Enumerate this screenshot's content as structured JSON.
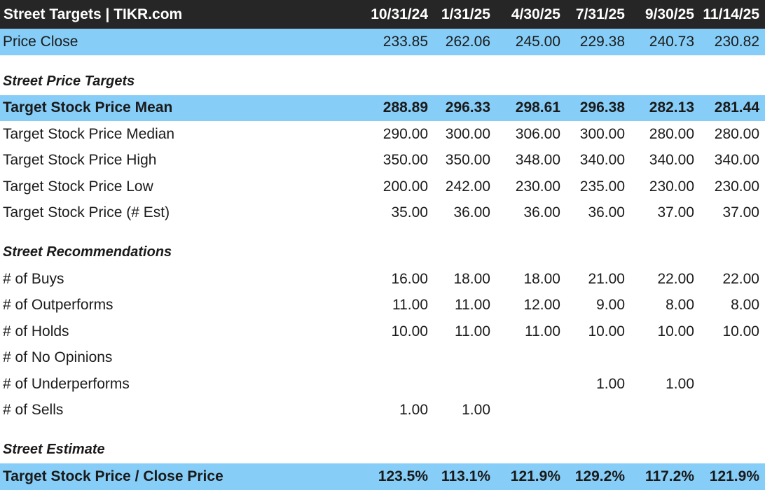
{
  "header": {
    "title": "Street Targets | TIKR.com",
    "dates": [
      "10/31/24",
      "1/31/25",
      "4/30/25",
      "7/31/25",
      "9/30/25",
      "11/14/25"
    ]
  },
  "price_close": {
    "label": "Price Close",
    "values": [
      "233.85",
      "262.06",
      "245.00",
      "229.38",
      "240.73",
      "230.82"
    ]
  },
  "sections": {
    "price_targets": "Street Price Targets",
    "recommendations": "Street Recommendations",
    "estimate": "Street Estimate"
  },
  "target_rows": [
    {
      "label": "Target Stock Price Mean",
      "values": [
        "288.89",
        "296.33",
        "298.61",
        "296.38",
        "282.13",
        "281.44"
      ]
    },
    {
      "label": "Target Stock Price Median",
      "values": [
        "290.00",
        "300.00",
        "306.00",
        "300.00",
        "280.00",
        "280.00"
      ]
    },
    {
      "label": "Target Stock Price High",
      "values": [
        "350.00",
        "350.00",
        "348.00",
        "340.00",
        "340.00",
        "340.00"
      ]
    },
    {
      "label": "Target Stock Price Low",
      "values": [
        "200.00",
        "242.00",
        "230.00",
        "235.00",
        "230.00",
        "230.00"
      ]
    },
    {
      "label": "Target Stock Price (# Est)",
      "values": [
        "35.00",
        "36.00",
        "36.00",
        "36.00",
        "37.00",
        "37.00"
      ]
    }
  ],
  "recommendation_rows": [
    {
      "label": "# of Buys",
      "values": [
        "16.00",
        "18.00",
        "18.00",
        "21.00",
        "22.00",
        "22.00"
      ]
    },
    {
      "label": "# of Outperforms",
      "values": [
        "11.00",
        "11.00",
        "12.00",
        "9.00",
        "8.00",
        "8.00"
      ]
    },
    {
      "label": "# of Holds",
      "values": [
        "10.00",
        "11.00",
        "11.00",
        "10.00",
        "10.00",
        "10.00"
      ]
    },
    {
      "label": "# of No Opinions",
      "values": [
        "",
        "",
        "",
        "",
        "",
        ""
      ]
    },
    {
      "label": "# of Underperforms",
      "values": [
        "",
        "",
        "",
        "1.00",
        "1.00",
        ""
      ]
    },
    {
      "label": "# of Sells",
      "values": [
        "1.00",
        "1.00",
        "",
        "",
        "",
        ""
      ]
    }
  ],
  "estimate_row": {
    "label": "Target Stock Price / Close Price",
    "values": [
      "123.5%",
      "113.1%",
      "121.9%",
      "129.2%",
      "117.2%",
      "121.9%"
    ]
  },
  "colors": {
    "header_bg": "#262626",
    "highlight_bg": "#86cdf7"
  }
}
